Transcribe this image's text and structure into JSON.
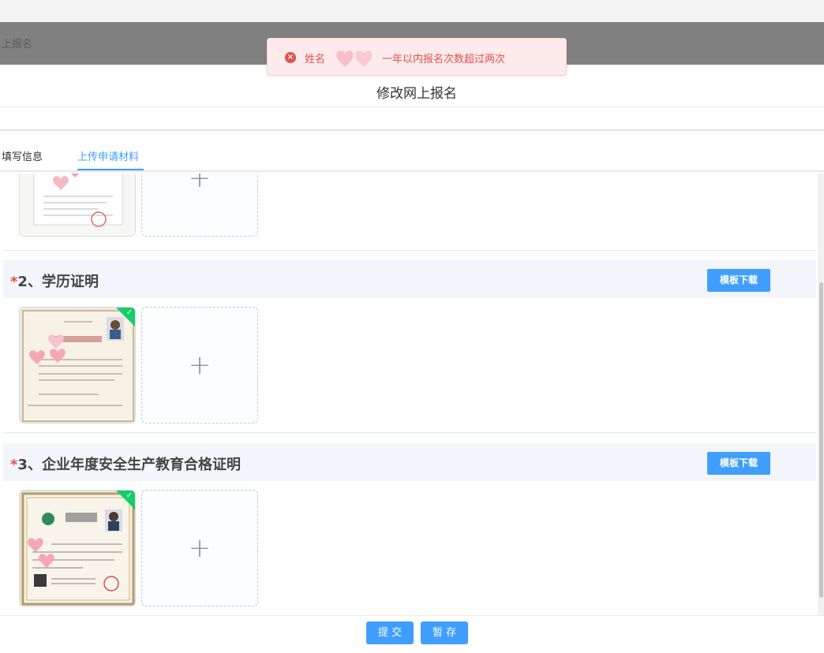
{
  "colors": {
    "primary": "#409eff",
    "error": "#e25050",
    "success": "#13ce66",
    "required": "#e25050"
  },
  "header": {
    "background_title": "上报名"
  },
  "toast": {
    "prefix": "姓名",
    "suffix": "一年以内报名次数超过两次",
    "icon": "close-circle-icon"
  },
  "dialog": {
    "title": "修改网上报名"
  },
  "tabs": [
    {
      "label": "填写信息",
      "active": false
    },
    {
      "label": "上传申请材料",
      "active": true
    }
  ],
  "sections": [
    {
      "required_mark": "*",
      "title": "2、学历证明",
      "download_label": "模板下载",
      "uploaded": true,
      "add_icon": "plus-icon"
    },
    {
      "required_mark": "*",
      "title": "3、企业年度安全生产教育合格证明",
      "download_label": "模板下载",
      "uploaded": true,
      "add_icon": "plus-icon"
    }
  ],
  "footer": {
    "submit_label": "提 交",
    "save_label": "暂 存"
  }
}
